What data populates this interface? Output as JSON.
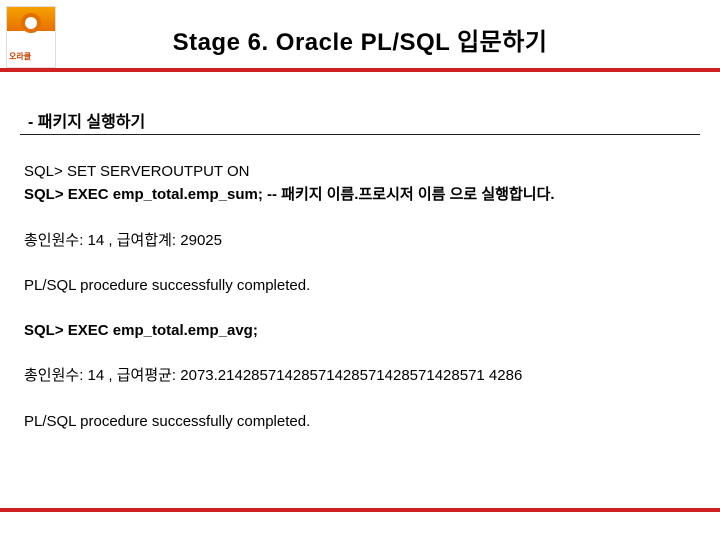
{
  "logo_text": "오라클",
  "title": "Stage 6. Oracle PL/SQL 입문하기",
  "subtitle": "- 패키지 실행하기",
  "lines": {
    "l1a": "SQL> SET SERVEROUTPUT ON",
    "l1b": "SQL> EXEC emp_total.emp_sum; -- 패키지 이름.프로시저 이름 으로 실행합니다.",
    "l2": "총인원수: 14 , 급여합계: 29025",
    "l3": "PL/SQL procedure successfully completed.",
    "l4": "SQL> EXEC emp_total.emp_avg;",
    "l5": "총인원수: 14 , 급여평균: 2073.21428571428571428571428571428571 4286",
    "l6": "PL/SQL procedure successfully completed."
  }
}
